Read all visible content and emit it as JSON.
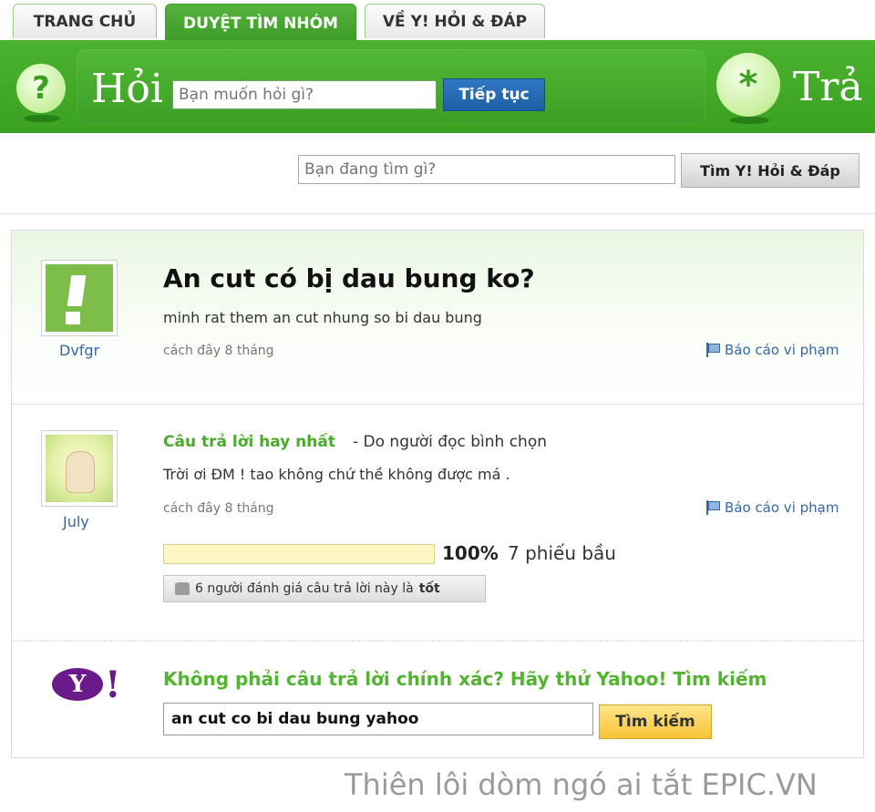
{
  "tabs": [
    {
      "label": "TRANG CHỦ"
    },
    {
      "label": "DUYỆT TÌM NHÓM",
      "active": true
    },
    {
      "label": "VỀ Y! HỎI & ĐÁP"
    }
  ],
  "header": {
    "ask_title": "Hỏi",
    "ask_placeholder": "Bạn muốn hỏi gì?",
    "ask_button": "Tiếp tục",
    "answer_title": "Trả l"
  },
  "search": {
    "placeholder": "Bạn đang tìm gì?",
    "button": "Tìm Y! Hỏi & Đáp"
  },
  "question": {
    "user": "Dvfgr",
    "title": "An cut có bị dau bung ko?",
    "body": "minh rat them an cut nhung so bi dau bung",
    "time": "cách đây 8 tháng",
    "report": "Báo cáo vi phạm"
  },
  "answer": {
    "user": "July",
    "best_label": "Câu trả lời hay nhất",
    "best_note": "- Do người đọc bình chọn",
    "body": "Trời ơi ĐM ! tao không chứ thề không được má .",
    "time": "cách đây 8 tháng",
    "report": "Báo cáo vi phạm",
    "vote_percent": "100%",
    "vote_fraction": 1.0,
    "vote_count": "7 phiếu bầu",
    "rating_text": "6 người đánh giá câu trả lời này là",
    "rating_strong": "tốt"
  },
  "yahoo": {
    "logo_text": "Y",
    "logo_bang": "!",
    "prompt": "Không phải câu trả lời chính xác? Hãy thử Yahoo! Tìm kiếm",
    "input_value": "an cut co bi dau bung yahoo",
    "button": "Tìm kiếm"
  },
  "watermark": "Thiên lôi dòm ngó ai tắt EPIC.VN",
  "colors": {
    "header_green": "#3aa220",
    "link_blue": "#3467a8",
    "best_answer_green": "#4aab2a",
    "yahoo_purple": "#6b1a8a"
  }
}
